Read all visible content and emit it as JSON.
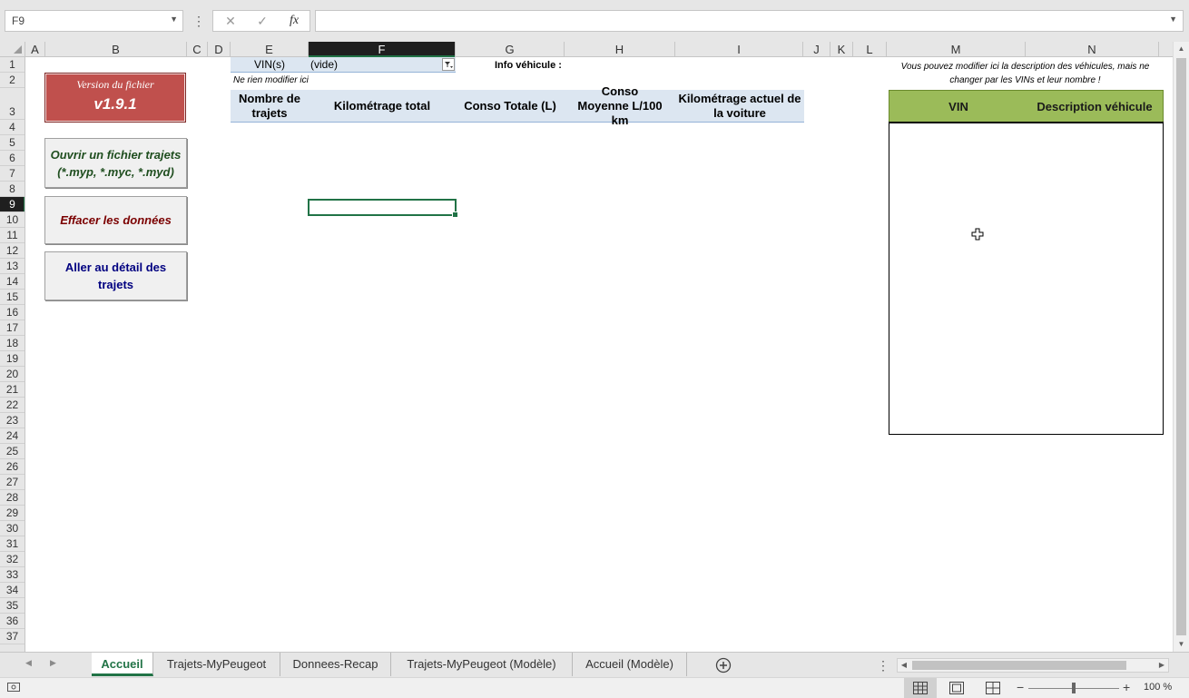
{
  "formula_bar": {
    "name_box": "F9",
    "formula": ""
  },
  "columns": [
    {
      "label": "A",
      "w": 22
    },
    {
      "label": "B",
      "w": 156
    },
    {
      "label": "C",
      "w": 23
    },
    {
      "label": "D",
      "w": 25
    },
    {
      "label": "E",
      "w": 86
    },
    {
      "label": "F",
      "w": 162
    },
    {
      "label": "G",
      "w": 120
    },
    {
      "label": "H",
      "w": 122
    },
    {
      "label": "I",
      "w": 141
    },
    {
      "label": "J",
      "w": 30
    },
    {
      "label": "K",
      "w": 25
    },
    {
      "label": "L",
      "w": 37
    },
    {
      "label": "M",
      "w": 153
    },
    {
      "label": "N",
      "w": 147
    }
  ],
  "selected_column": "F",
  "selected_row": "9",
  "rows": [
    "1",
    "2",
    "3",
    "4",
    "5",
    "6",
    "7",
    "8",
    "9",
    "10",
    "11",
    "12",
    "13",
    "14",
    "15",
    "16",
    "17",
    "18",
    "19",
    "20",
    "21",
    "22",
    "23",
    "24",
    "25",
    "26",
    "27",
    "28",
    "29",
    "30",
    "31",
    "32",
    "33",
    "34",
    "35",
    "36",
    "37"
  ],
  "version_box": {
    "label": "Version du fichier",
    "value": "v1.9.1"
  },
  "buttons": {
    "open_file": "Ouvrir un fichier trajets (*.myp, *.myc, *.myd)",
    "clear_data": "Effacer les données",
    "go_detail": "Aller au détail des trajets"
  },
  "filter": {
    "label": "VIN(s)",
    "value": "(vide)"
  },
  "info_vehicule_label": "Info véhicule :",
  "note": "Ne rien modifier ici",
  "table_headers": [
    "Nombre de trajets",
    "Kilométrage total",
    "Conso Totale (L)",
    "Conso Moyenne L/100 km",
    "Kilométrage actuel de la voiture"
  ],
  "vehicle_note": "Vous pouvez modifier ici la description des véhicules, mais ne changer par les VINs et leur nombre !",
  "vehicle_table": {
    "col_vin": "VIN",
    "col_desc": "Description véhicule"
  },
  "tabs": [
    "Accueil",
    "Trajets-MyPeugeot",
    "Donnees-Recap",
    "Trajets-MyPeugeot (Modèle)",
    "Accueil (Modèle)"
  ],
  "active_tab": "Accueil",
  "status": {
    "zoom": "100 %"
  },
  "colors": {
    "accent": "#217346",
    "version_bg": "#c0504d",
    "header_blue": "#dce6f1",
    "header_green": "#9bbb59",
    "open_text": "#1f4e1f",
    "clear_text": "#7b0000",
    "detail_text": "#000080"
  }
}
